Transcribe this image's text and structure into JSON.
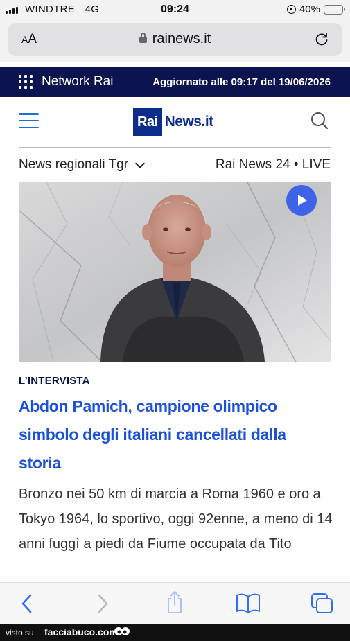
{
  "status_bar": {
    "carrier": "WINDTRE",
    "network": "4G",
    "time": "09:24",
    "battery": "40%",
    "battery_level": 0.4
  },
  "browser": {
    "text_size_label": "AA",
    "url": "rainews.it"
  },
  "network_bar": {
    "label": "Network Rai",
    "updated": "Aggiornato alle 09:17 del 19/06/2026",
    "background": "#0c1450"
  },
  "site": {
    "logo_rai": "Rai",
    "logo_news": "News.it",
    "brand_color": "#0c2d8c",
    "accent_color": "#1b52d8"
  },
  "subnav": {
    "regional": "News regionali Tgr",
    "live": "Rai News 24 • LIVE"
  },
  "article": {
    "kicker": "L’INTERVISTA",
    "headline": "Abdon Pamich, campione olimpico simbolo degli italiani cancellati dalla storia",
    "summary": "Bronzo nei 50 km di marcia a Roma 1960 e oro a Tokyo 1964, lo sportivo, oggi 92enne, a meno di 14 anni fuggì a piedi da Fiume occupata da Tito"
  },
  "icons": {
    "menu": "hamburger-menu-icon",
    "search": "search-icon",
    "play": "play-icon",
    "back": "chevron-left-icon",
    "forward": "chevron-right-icon",
    "share": "share-icon",
    "bookmarks": "book-icon",
    "tabs": "tabs-icon"
  },
  "watermark": {
    "prefix": "visto su",
    "brand": "facciabuco.com"
  }
}
